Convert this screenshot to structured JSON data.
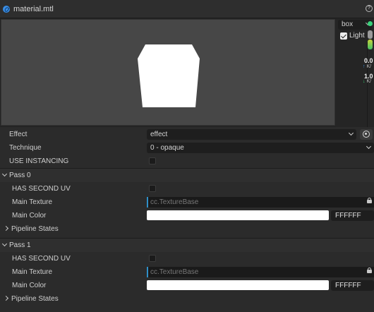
{
  "window": {
    "title": "material.mtl"
  },
  "preview": {
    "model_select": "box",
    "light_label": "Light",
    "light_checked": true,
    "stats": [
      {
        "value": "0.0",
        "sub": "K/",
        "dir": "up"
      },
      {
        "value": "1.0",
        "sub": "K/",
        "dir": "down"
      }
    ]
  },
  "properties": {
    "effect": {
      "label": "Effect",
      "value": "effect"
    },
    "technique": {
      "label": "Technique",
      "value": "0 - opaque"
    },
    "use_instancing": {
      "label": "USE INSTANCING",
      "checked": false
    }
  },
  "passes": [
    {
      "title": "Pass 0",
      "has_second_uv": {
        "label": "HAS SECOND UV",
        "checked": false
      },
      "main_texture": {
        "label": "Main Texture",
        "value": "cc.TextureBase"
      },
      "main_color": {
        "label": "Main Color",
        "hex": "FFFFFF",
        "color": "#ffffff"
      },
      "pipeline_states": {
        "label": "Pipeline States"
      }
    },
    {
      "title": "Pass 1",
      "has_second_uv": {
        "label": "HAS SECOND UV",
        "checked": false
      },
      "main_texture": {
        "label": "Main Texture",
        "value": "cc.TextureBase"
      },
      "main_color": {
        "label": "Main Color",
        "hex": "FFFFFF",
        "color": "#ffffff"
      },
      "pipeline_states": {
        "label": "Pipeline States"
      }
    }
  ],
  "colors": {
    "accent": "#2f8fc8",
    "background": "#2b2b2b",
    "field": "#1e1e1e"
  }
}
